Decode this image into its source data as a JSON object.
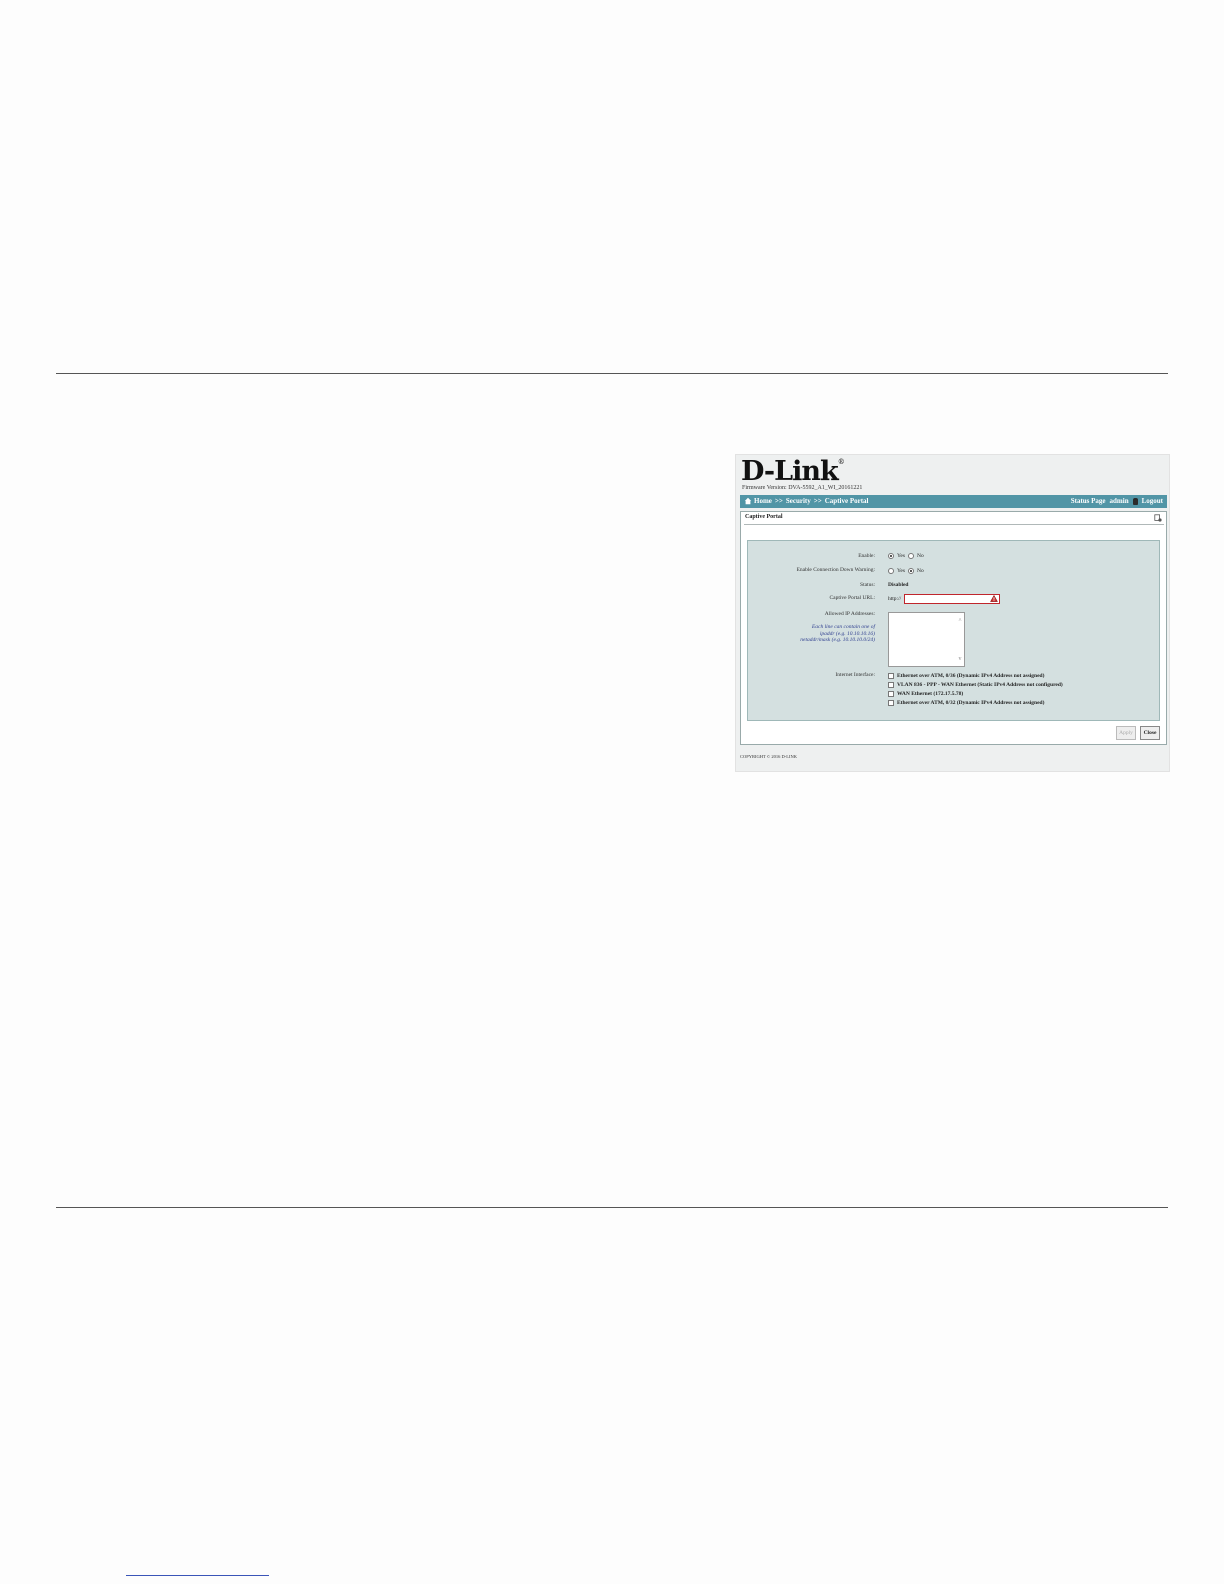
{
  "brand": {
    "logo_text": "D-Link",
    "registered_mark": "®"
  },
  "firmware": "Firmware Version: DVA-5592_A1_WI_20161221",
  "nav": {
    "breadcrumb": [
      "Home",
      ">>",
      "Security",
      ">>",
      "Captive Portal"
    ],
    "status_page": "Status Page",
    "user": "admin",
    "logout": "Logout",
    "colors": {
      "bar": "#5195a6"
    }
  },
  "window": {
    "title": "Captive Portal",
    "fields": {
      "enable": {
        "label": "Enable:",
        "options": [
          "Yes",
          "No"
        ],
        "selected": "Yes"
      },
      "conn_warning": {
        "label": "Enable Connection Down Warning:",
        "options": [
          "Yes",
          "No"
        ],
        "selected": "No"
      },
      "status": {
        "label": "Status:",
        "value": "Disabled"
      },
      "url": {
        "label": "Captive Portal URL:",
        "prefix": "http://",
        "value": ""
      },
      "allowed_ips": {
        "label": "Allowed IP Addresses:",
        "hint": [
          "Each line can contain one of",
          "ipaddr (e.g. 10.10.10.16)",
          "netaddr/mask (e.g. 10.10.10.0/24)"
        ]
      },
      "interfaces": {
        "label": "Internet Interface:",
        "items": [
          "Ethernet over ATM, 0/36 (Dynamic IPv4 Address not assigned)",
          "VLAN 836 - PPP - WAN Ethernet (Static IPv4 Address not configured)",
          "WAN Ethernet (172.17.5.78)",
          "Ethernet over ATM, 0/32 (Dynamic IPv4 Address not assigned)"
        ]
      }
    },
    "buttons": {
      "apply": "Apply",
      "close": "Close"
    }
  },
  "copyright": "COPYRIGHT © 2016 D-LINK"
}
